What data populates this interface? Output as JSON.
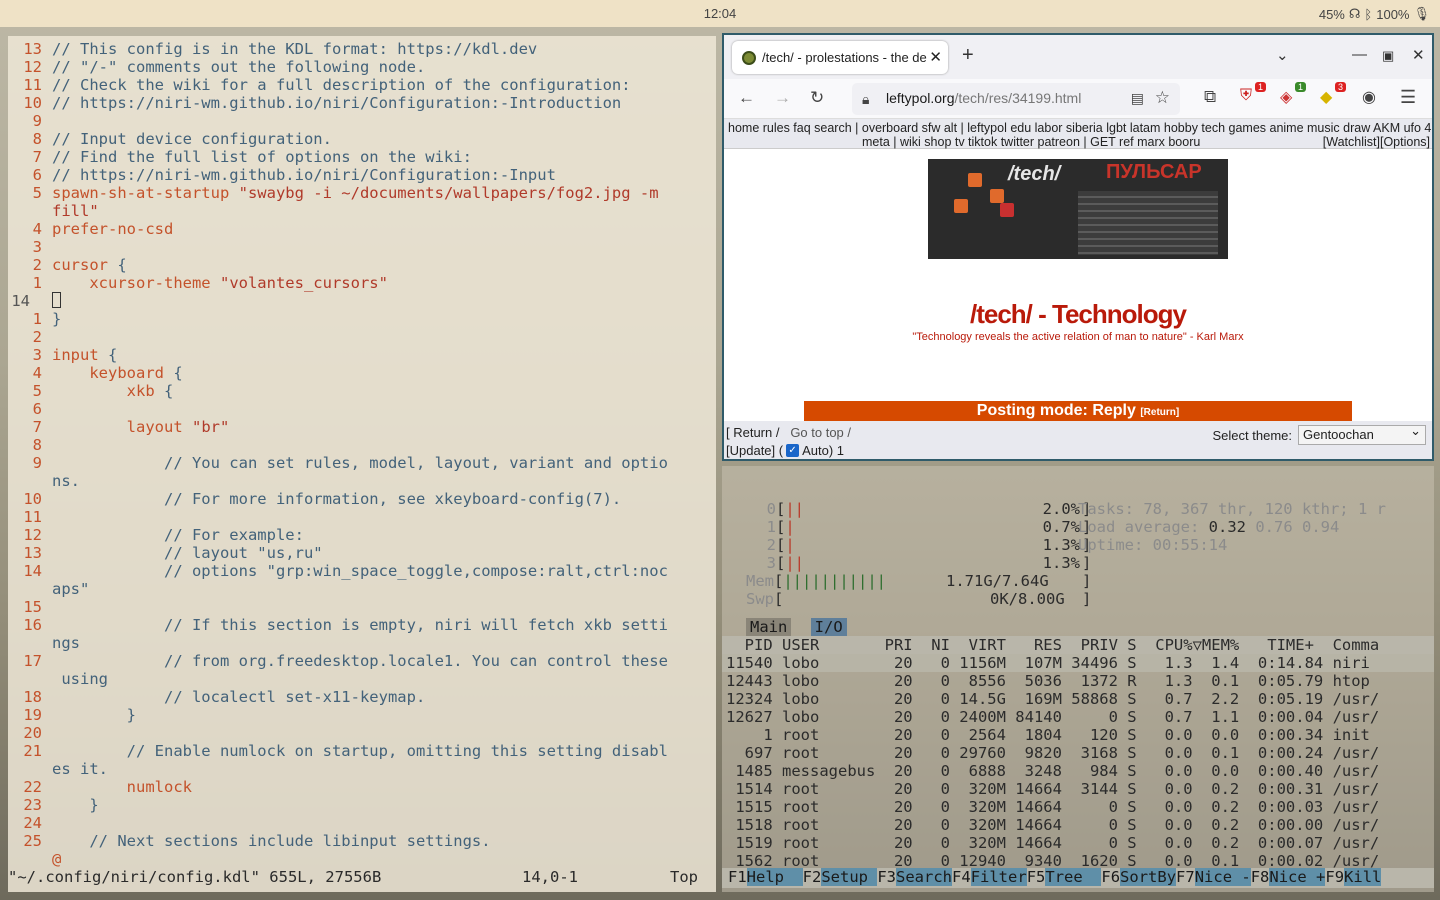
{
  "topbar": {
    "clock": "12:04",
    "volume": "45%",
    "battery": "100%"
  },
  "vim": {
    "lines": [
      {
        "num": "13",
        "segs": [
          [
            "cmt",
            "// This config is in the KDL format: https://kdl.dev"
          ]
        ]
      },
      {
        "num": "12",
        "segs": [
          [
            "cmt",
            "// \"/-\" comments out the following node."
          ]
        ]
      },
      {
        "num": "11",
        "segs": [
          [
            "cmt",
            "// Check the wiki for a full description of the configuration:"
          ]
        ]
      },
      {
        "num": "10",
        "segs": [
          [
            "cmt",
            "// https://niri-wm.github.io/niri/Configuration:-Introduction"
          ]
        ]
      },
      {
        "num": "9",
        "segs": []
      },
      {
        "num": "8",
        "segs": [
          [
            "cmt",
            "// Input device configuration."
          ]
        ]
      },
      {
        "num": "7",
        "segs": [
          [
            "cmt",
            "// Find the full list of options on the wiki:"
          ]
        ]
      },
      {
        "num": "6",
        "segs": [
          [
            "cmt",
            "// https://niri-wm.github.io/niri/Configuration:-Input"
          ]
        ]
      },
      {
        "num": "5",
        "segs": [
          [
            "kw",
            "spawn-sh-at-startup "
          ],
          [
            "str",
            "\"swaybg -i ~/documents/wallpapers/fog2.jpg -m"
          ]
        ]
      },
      {
        "num": "",
        "segs": [
          [
            "str",
            "fill\""
          ]
        ]
      },
      {
        "num": "4",
        "segs": [
          [
            "kw",
            "prefer-no-csd"
          ]
        ]
      },
      {
        "num": "3",
        "segs": []
      },
      {
        "num": "2",
        "segs": [
          [
            "kw",
            "cursor"
          ],
          [
            "cmt",
            " {"
          ]
        ]
      },
      {
        "num": "1",
        "segs": [
          [
            "kw",
            "    xcursor-theme "
          ],
          [
            "str",
            "\"volantes_cursors\""
          ]
        ]
      },
      {
        "num": "14",
        "segs": [],
        "cursor": true
      },
      {
        "num": "1",
        "segs": [
          [
            "cmt",
            "}"
          ]
        ]
      },
      {
        "num": "2",
        "segs": []
      },
      {
        "num": "3",
        "segs": [
          [
            "kw",
            "input"
          ],
          [
            "cmt",
            " {"
          ]
        ]
      },
      {
        "num": "4",
        "segs": [
          [
            "kw",
            "    keyboard"
          ],
          [
            "cmt",
            " {"
          ]
        ]
      },
      {
        "num": "5",
        "segs": [
          [
            "kw",
            "        xkb"
          ],
          [
            "cmt",
            " {"
          ]
        ]
      },
      {
        "num": "6",
        "segs": []
      },
      {
        "num": "7",
        "segs": [
          [
            "kw",
            "        layout "
          ],
          [
            "str",
            "\"br\""
          ]
        ]
      },
      {
        "num": "8",
        "segs": []
      },
      {
        "num": "9",
        "segs": [
          [
            "cmt",
            "            // You can set rules, model, layout, variant and optio"
          ]
        ]
      },
      {
        "num": "",
        "segs": [
          [
            "cmt",
            "ns."
          ]
        ]
      },
      {
        "num": "10",
        "segs": [
          [
            "cmt",
            "            // For more information, see xkeyboard-config(7)."
          ]
        ]
      },
      {
        "num": "11",
        "segs": []
      },
      {
        "num": "12",
        "segs": [
          [
            "cmt",
            "            // For example:"
          ]
        ]
      },
      {
        "num": "13",
        "segs": [
          [
            "cmt",
            "            // layout \"us,ru\""
          ]
        ]
      },
      {
        "num": "14",
        "segs": [
          [
            "cmt",
            "            // options \"grp:win_space_toggle,compose:ralt,ctrl:noc"
          ]
        ]
      },
      {
        "num": "",
        "segs": [
          [
            "cmt",
            "aps\""
          ]
        ]
      },
      {
        "num": "15",
        "segs": []
      },
      {
        "num": "16",
        "segs": [
          [
            "cmt",
            "            // If this section is empty, niri will fetch xkb setti"
          ]
        ]
      },
      {
        "num": "",
        "segs": [
          [
            "cmt",
            "ngs"
          ]
        ]
      },
      {
        "num": "17",
        "segs": [
          [
            "cmt",
            "            // from org.freedesktop.locale1. You can control these"
          ]
        ]
      },
      {
        "num": "",
        "segs": [
          [
            "cmt",
            " using"
          ]
        ]
      },
      {
        "num": "18",
        "segs": [
          [
            "cmt",
            "            // localectl set-x11-keymap."
          ]
        ]
      },
      {
        "num": "19",
        "segs": [
          [
            "cmt",
            "        }"
          ]
        ]
      },
      {
        "num": "20",
        "segs": []
      },
      {
        "num": "21",
        "segs": [
          [
            "cmt",
            "        // Enable numlock on startup, omitting this setting disabl"
          ]
        ]
      },
      {
        "num": "",
        "segs": [
          [
            "cmt",
            "es it."
          ]
        ]
      },
      {
        "num": "22",
        "segs": [
          [
            "kw",
            "        numlock"
          ]
        ]
      },
      {
        "num": "23",
        "segs": [
          [
            "cmt",
            "    }"
          ]
        ]
      },
      {
        "num": "24",
        "segs": []
      },
      {
        "num": "25",
        "segs": [
          [
            "cmt",
            "    // Next sections include libinput settings."
          ]
        ]
      },
      {
        "num": "",
        "segs": [
          [
            "at",
            "@"
          ]
        ]
      }
    ],
    "status_file": "\"~/.config/niri/config.kdl\" 655L, 27556B",
    "status_pos": "14,0-1",
    "status_scroll": "Top"
  },
  "browser": {
    "tab_title": "/tech/ - prolestations - the de",
    "url_host": "leftypol.org",
    "url_path": "/tech/res/34199.html",
    "ext_badges": [
      "1",
      "1",
      "3"
    ],
    "boardlist_1": "home rules faq search | overboard sfw alt | leftypol edu labor siberia lgbt latam hobby tech games anime music draw AKM ufo 420",
    "boardlist_2": "meta | wiki shop tv tiktok twitter patreon | GET ref marx booru",
    "boardlist_3": "[Watchlist][Options]",
    "banner_left": "/tech/",
    "banner_right": "ПУЛЬСАР",
    "board_title": "/tech/ - Technology",
    "board_subtitle": "\"Technology reveals the active relation of man to nature\" - Karl Marx",
    "posting_mode": "Posting mode: Reply",
    "posting_return": "[Return]",
    "return_link": "[ Return /",
    "top_link": "Go to top /",
    "update_link": "[Update] (",
    "auto_label": "Auto) 1",
    "theme_label": "Select theme:",
    "theme_value": "Gentoochan"
  },
  "htop": {
    "cpus": [
      {
        "id": "0",
        "bar": "||",
        "pct": "2.0%"
      },
      {
        "id": "1",
        "bar": "|",
        "pct": "0.7%"
      },
      {
        "id": "2",
        "bar": "|",
        "pct": "1.3%"
      },
      {
        "id": "3",
        "bar": "||",
        "pct": "1.3%"
      }
    ],
    "mem": {
      "label": "Mem",
      "bar": "|||||||||||",
      "val": "1.71G/7.64G"
    },
    "swp": {
      "label": "Swp",
      "val": "0K/8.00G"
    },
    "tasks_line": "Tasks: 78, 367 thr, 120 kthr; 1 r",
    "load_label": "Load average:",
    "load1": "0.32",
    "load_rest": "0.76 0.94",
    "uptime_line": "Uptime: 00:55:14",
    "tab_main": "Main",
    "tab_io": "I/O",
    "header": "  PID USER       PRI  NI  VIRT   RES  PRIV S  CPU%▽MEM%   TIME+  Comma",
    "rows": [
      "11540 lobo        20   0 1156M  107M 34496 S   1.3  1.4  0:14.84 niri",
      "12443 lobo        20   0  8556  5036  1372 R   1.3  0.1  0:05.79 htop",
      "12324 lobo        20   0 14.5G  169M 58868 S   0.7  2.2  0:05.19 /usr/",
      "12627 lobo        20   0 2400M 84140     0 S   0.7  1.1  0:00.04 /usr/",
      "    1 root        20   0  2564  1804   120 S   0.0  0.0  0:00.34 init",
      "  697 root        20   0 29760  9820  3168 S   0.0  0.1  0:00.24 /usr/",
      " 1485 messagebus  20   0  6888  3248   984 S   0.0  0.0  0:00.40 /usr/",
      " 1514 root        20   0  320M 14664  3144 S   0.0  0.2  0:00.31 /usr/",
      " 1515 root        20   0  320M 14664     0 S   0.0  0.2  0:00.03 /usr/",
      " 1518 root        20   0  320M 14664     0 S   0.0  0.2  0:00.00 /usr/",
      " 1519 root        20   0  320M 14664     0 S   0.0  0.2  0:00.07 /usr/",
      " 1562 root        20   0 12940  9340  1620 S   0.0  0.1  0:00.02 /usr/"
    ],
    "fkeys": [
      [
        "F1",
        "Help  "
      ],
      [
        "F2",
        "Setup "
      ],
      [
        "F3",
        "Search"
      ],
      [
        "F4",
        "Filter"
      ],
      [
        "F5",
        "Tree  "
      ],
      [
        "F6",
        "SortBy"
      ],
      [
        "F7",
        "Nice -"
      ],
      [
        "F8",
        "Nice +"
      ],
      [
        "F9",
        "Kill"
      ]
    ]
  }
}
